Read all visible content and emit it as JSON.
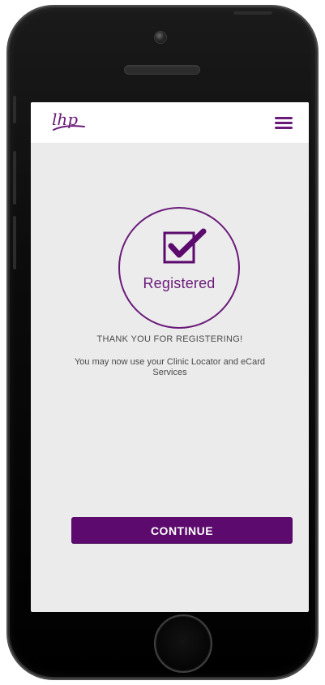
{
  "app": {
    "logo_text": "lhp",
    "menu_icon": "hamburger-menu-icon"
  },
  "status": {
    "label": "Registered",
    "icon": "checkbox-checked-icon"
  },
  "message": {
    "title": "THANK YOU FOR REGISTERING!",
    "body": "You may now use your Clinic Locator and eCard Services"
  },
  "actions": {
    "continue_label": "CONTINUE"
  },
  "device": {
    "home_button_icon": "home-button"
  },
  "colors": {
    "brand_purple": "#5c0a6d",
    "accent_purple": "#6a1b7a",
    "screen_bg": "#ebebeb",
    "header_bg": "#ffffff",
    "body_text": "#4a4a4a",
    "device_black": "#0b0b0b"
  }
}
